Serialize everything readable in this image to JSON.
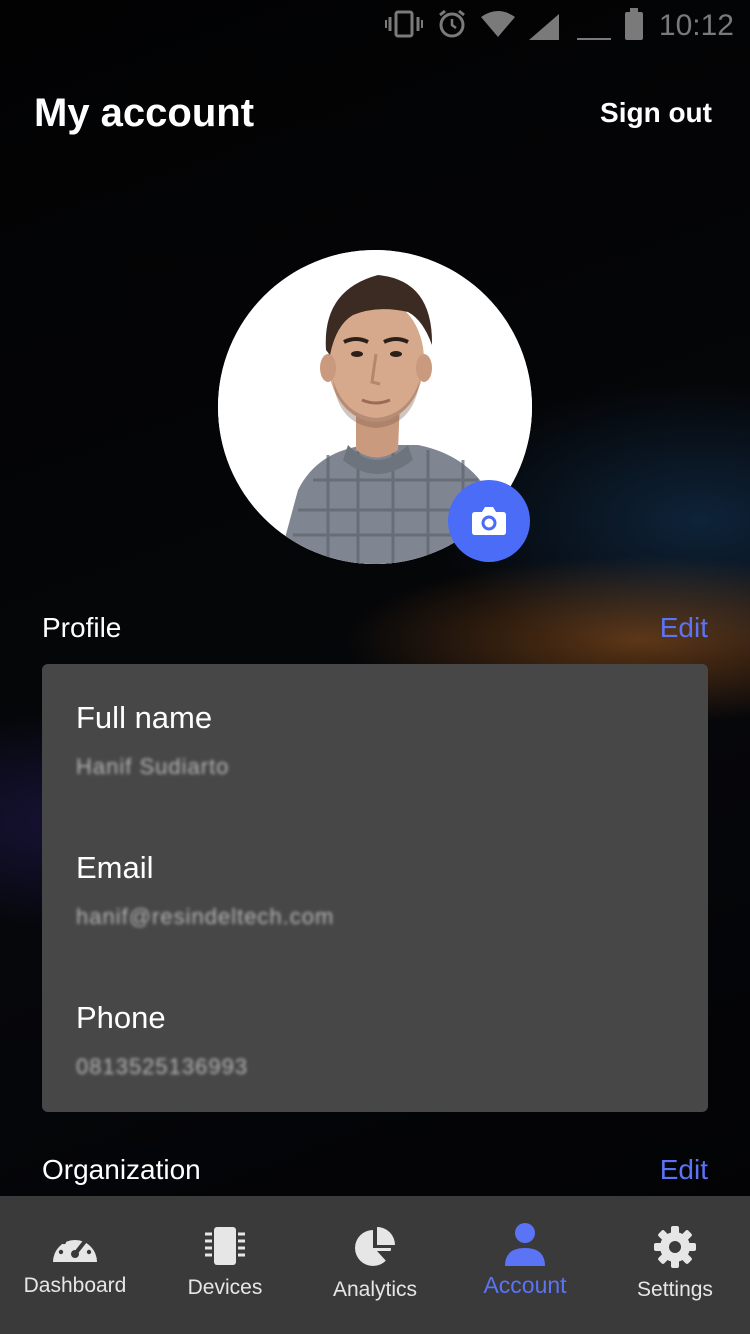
{
  "status_bar": {
    "time": "10:12",
    "icons": [
      "vibrate-icon",
      "alarm-icon",
      "wifi-icon",
      "signal-icon",
      "signal-outline-icon",
      "battery-icon"
    ]
  },
  "header": {
    "title": "My account",
    "sign_out_label": "Sign out"
  },
  "profile_section": {
    "title": "Profile",
    "edit_label": "Edit",
    "fields": [
      {
        "label": "Full name",
        "value": "Hanif Sudiarto"
      },
      {
        "label": "Email",
        "value": "hanif@resindeltech.com"
      },
      {
        "label": "Phone",
        "value": "0813525136993"
      }
    ]
  },
  "organization_section": {
    "title": "Organization",
    "edit_label": "Edit"
  },
  "accent_color": "#5b73f5",
  "tabs": [
    {
      "label": "Dashboard",
      "icon": "gauge-icon",
      "active": false
    },
    {
      "label": "Devices",
      "icon": "chip-icon",
      "active": false
    },
    {
      "label": "Analytics",
      "icon": "pie-chart-icon",
      "active": false
    },
    {
      "label": "Account",
      "icon": "person-icon",
      "active": true
    },
    {
      "label": "Settings",
      "icon": "gear-icon",
      "active": false
    }
  ]
}
